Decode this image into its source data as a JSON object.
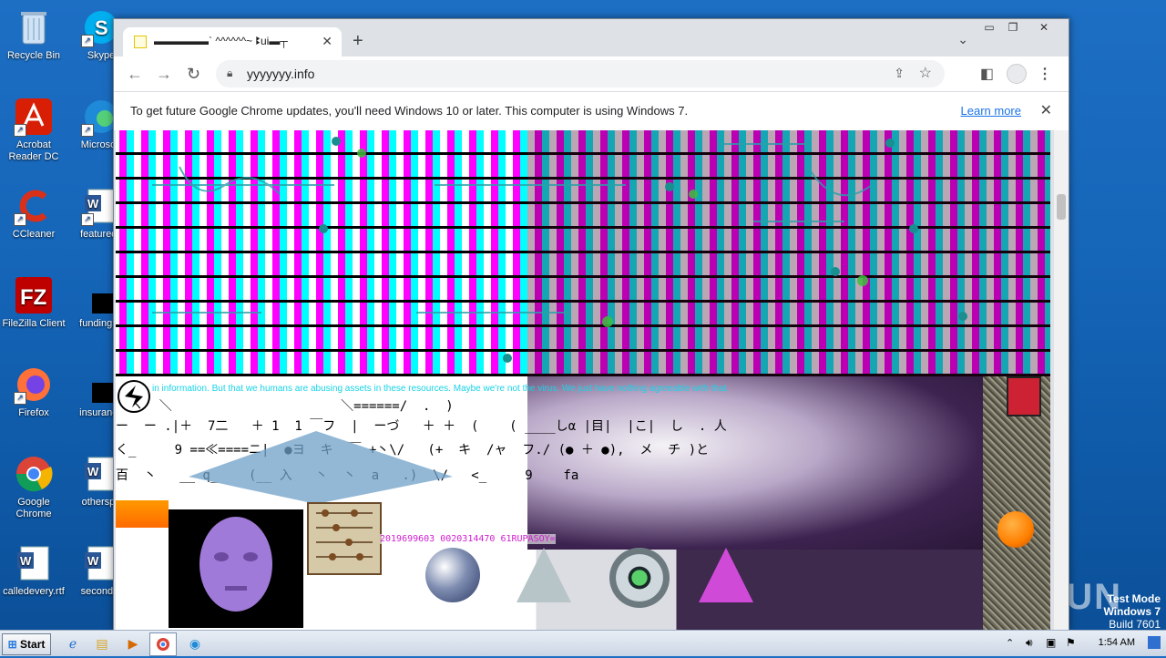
{
  "desktop": {
    "icons": [
      {
        "label": "Recycle Bin"
      },
      {
        "label": "Skype"
      },
      {
        "label": "Acrobat Reader DC"
      },
      {
        "label": "Microsoft"
      },
      {
        "label": "CCleaner"
      },
      {
        "label": "featureds"
      },
      {
        "label": "FileZilla Client"
      },
      {
        "label": "fundingse"
      },
      {
        "label": "Firefox"
      },
      {
        "label": "insurance"
      },
      {
        "label": "Google Chrome"
      },
      {
        "label": "otherspo"
      },
      {
        "label": "calledevery.rtf"
      },
      {
        "label": "secondto"
      }
    ],
    "watermark": "ANY RUN",
    "test_mode": [
      "Test Mode",
      "Windows 7",
      "Build 7601"
    ]
  },
  "taskbar": {
    "start_label": "Start",
    "clock": "1:54 AM"
  },
  "browser": {
    "tab_title": "▬▬▬▬▬` ^^^^^^~ ꔪui▬┬",
    "url": "yyyyyyy.info",
    "infobar_message": "To get future Google Chrome updates, you'll need Windows 10 or later. This computer is using Windows 7.",
    "infobar_link": "Learn more"
  },
  "page": {
    "banner": "in information. But that we humans are abusing assets in these resources. Maybe we're not the virus. We just have nothing agreeable with that.",
    "hex_line": "2019699603 0020314470 61RUPASOY="
  },
  "colors": {
    "desktop_bg": "#1565b8",
    "link": "#1a73e8",
    "grid_magenta": "#ff00ff",
    "grid_cyan": "#00ffff",
    "grid_red": "#ff0000",
    "grid_yellow": "#ffff00"
  }
}
